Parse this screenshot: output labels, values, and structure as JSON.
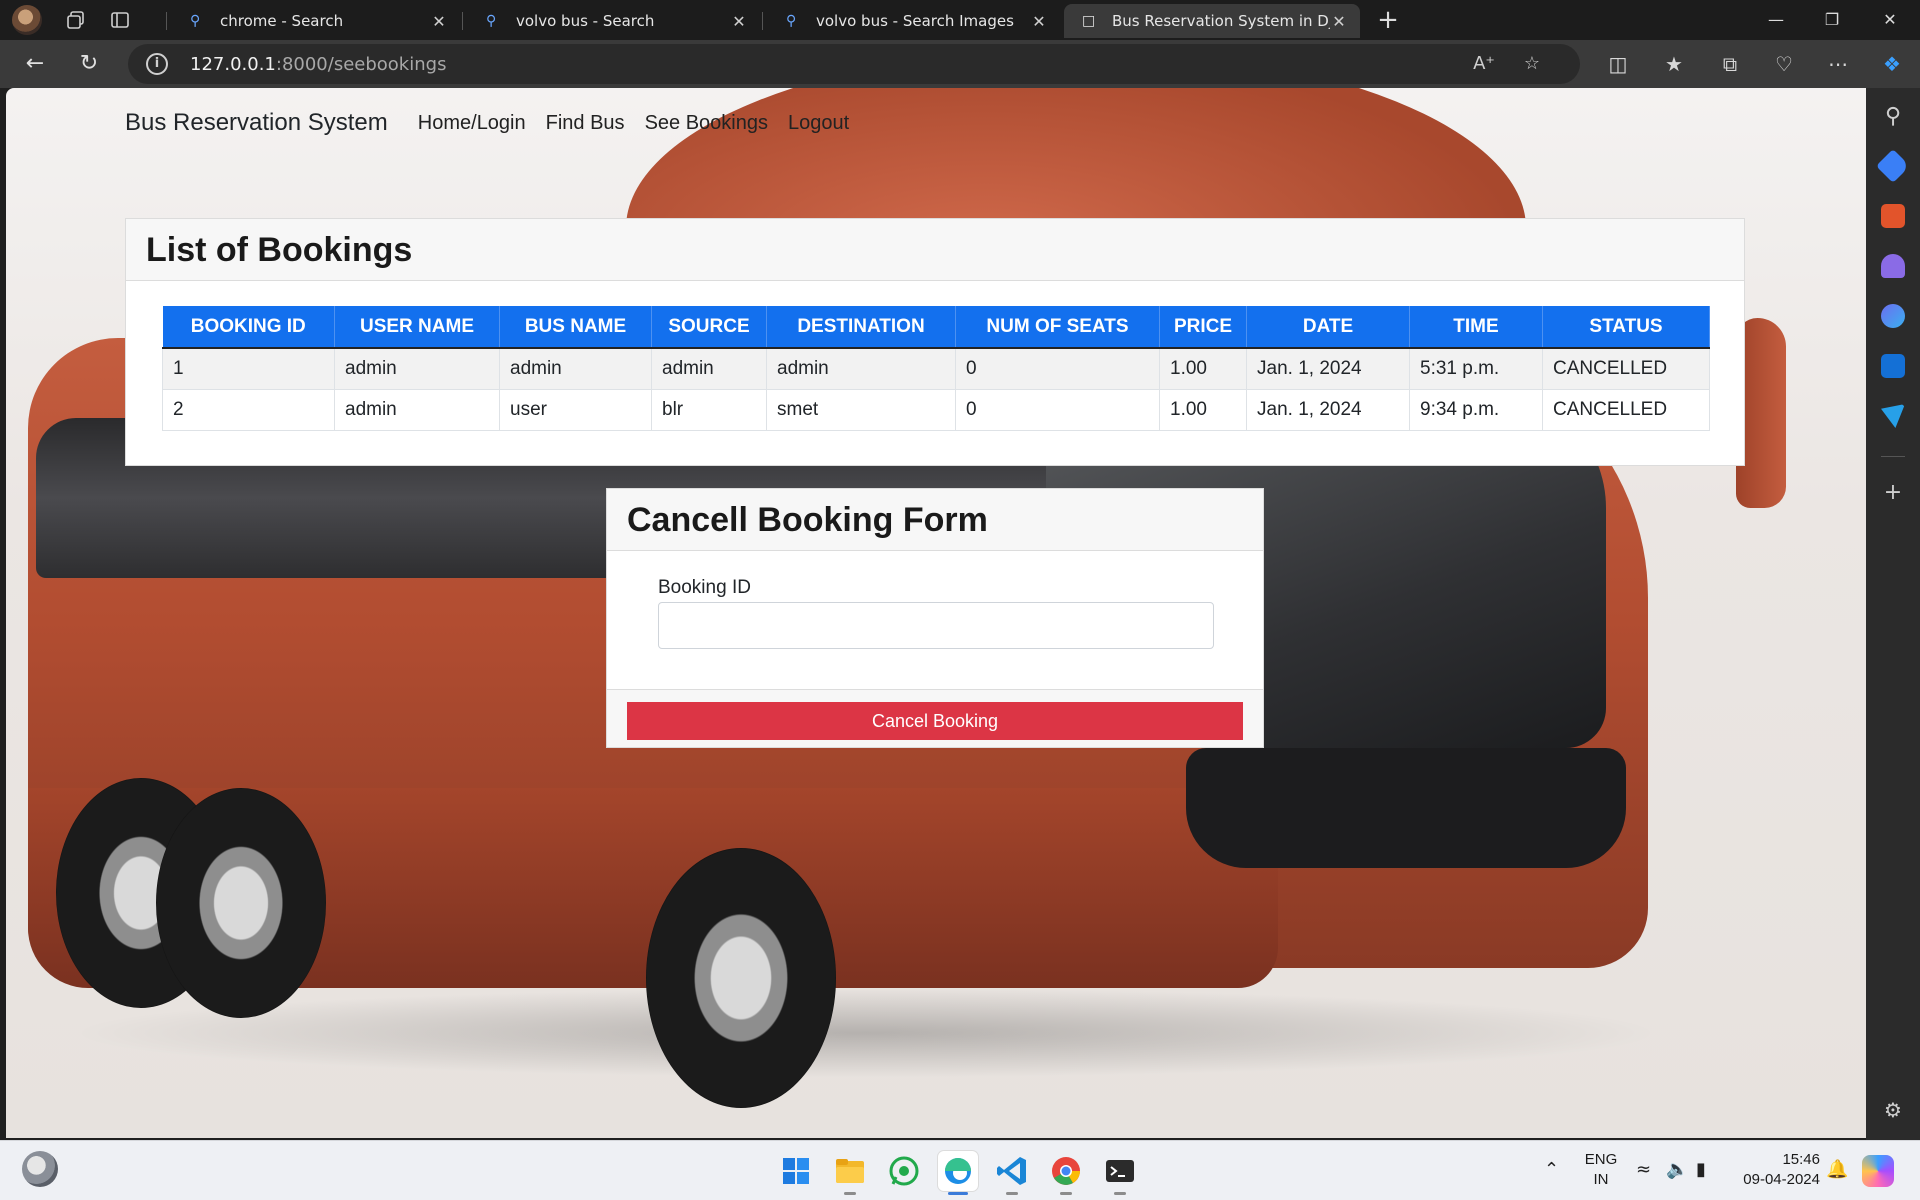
{
  "browser": {
    "tabs": [
      {
        "title": "chrome - Search",
        "icon": "search-icon"
      },
      {
        "title": "volvo bus - Search",
        "icon": "search-icon"
      },
      {
        "title": "volvo bus - Search Images",
        "icon": "search-icon"
      },
      {
        "title": "Bus Reservation System in Djang",
        "icon": "page-icon"
      }
    ],
    "url_host": "127.0.0.1",
    "url_rest": ":8000/seebookings"
  },
  "site": {
    "brand": "Bus Reservation System",
    "nav": [
      "Home/Login",
      "Find Bus",
      "See Bookings",
      "Logout"
    ]
  },
  "bookings": {
    "title": "List of Bookings",
    "columns": [
      "BOOKING ID",
      "USER NAME",
      "BUS NAME",
      "SOURCE",
      "DESTINATION",
      "NUM OF SEATS",
      "PRICE",
      "DATE",
      "TIME",
      "STATUS"
    ],
    "rows": [
      [
        "1",
        "admin",
        "admin",
        "admin",
        "admin",
        "0",
        "1.00",
        "Jan. 1, 2024",
        "5:31 p.m.",
        "CANCELLED"
      ],
      [
        "2",
        "admin",
        "user",
        "blr",
        "smet",
        "0",
        "1.00",
        "Jan. 1, 2024",
        "9:34 p.m.",
        "CANCELLED"
      ]
    ],
    "header_color": "#1370ee"
  },
  "cancel_form": {
    "title": "Cancell Booking Form",
    "field_label": "Booking ID",
    "field_value": "",
    "button_label": "Cancel Booking",
    "button_color": "#dc3545"
  },
  "taskbar": {
    "lang_top": "ENG",
    "lang_bottom": "IN",
    "time": "15:46",
    "date": "09-04-2024"
  }
}
